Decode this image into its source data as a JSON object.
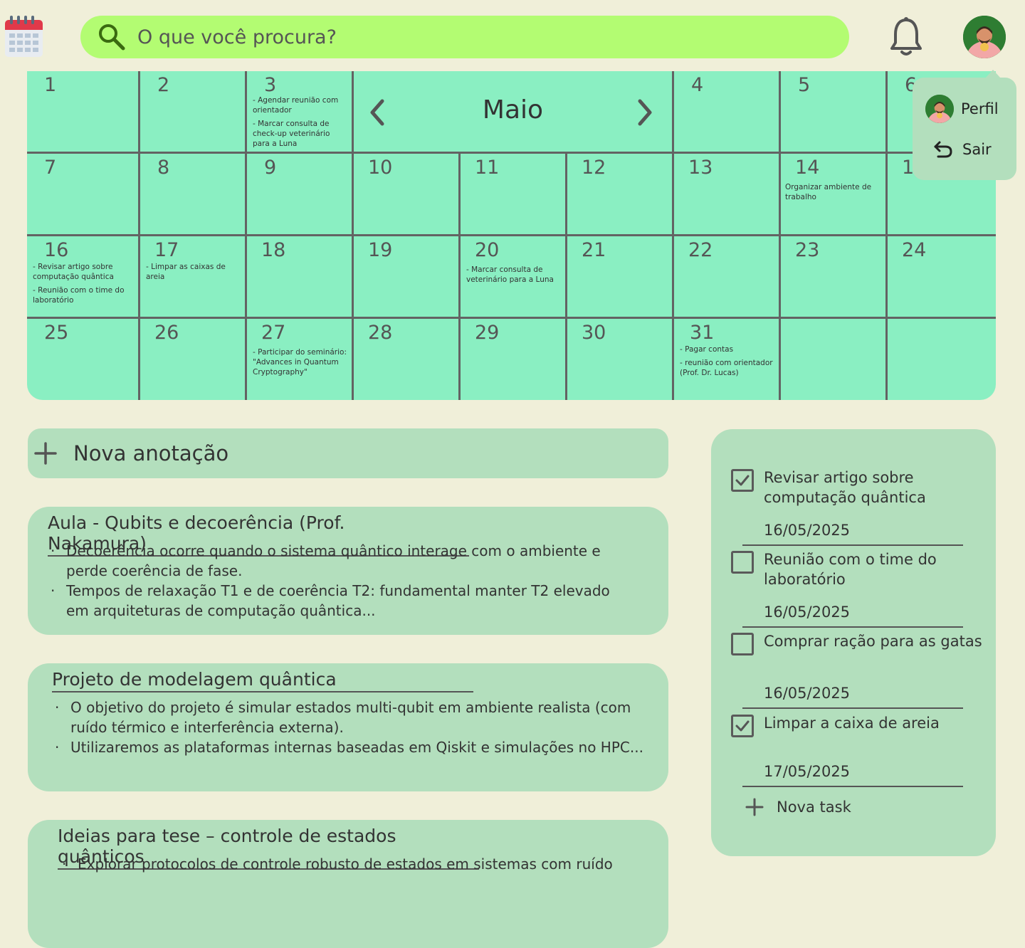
{
  "search": {
    "placeholder": "O que você procura?"
  },
  "calendar": {
    "month": "Maio",
    "days": {
      "d1": "1",
      "d2": "2",
      "d3": "3",
      "d4": "4",
      "d5": "5",
      "d6": "6",
      "d7": "7",
      "d8": "8",
      "d9": "9",
      "d10": "10",
      "d11": "11",
      "d12": "12",
      "d13": "13",
      "d14": "14",
      "d15": "15",
      "d16": "16",
      "d17": "17",
      "d18": "18",
      "d19": "19",
      "d20": "20",
      "d21": "21",
      "d22": "22",
      "d23": "23",
      "d24": "24",
      "d25": "25",
      "d26": "26",
      "d27": "27",
      "d28": "28",
      "d29": "29",
      "d30": "30",
      "d31": "31"
    },
    "events": {
      "d3": [
        "- Agendar reunião com orientador",
        "- Marcar consulta de check-up veterinário para a Luna"
      ],
      "d14": [
        "Organizar ambiente de trabalho"
      ],
      "d16": [
        "- Revisar artigo sobre computação quântica",
        "- Reunião com o time do laboratório"
      ],
      "d17": [
        "- Limpar as caixas de areia"
      ],
      "d20": [
        "- Marcar consulta de veterinário para a Luna"
      ],
      "d27": [
        "- Participar do seminário: \"Advances in Quantum Cryptography\""
      ],
      "d31": [
        "- Pagar contas",
        "- reunião com orientador (Prof. Dr. Lucas)"
      ]
    }
  },
  "profile_menu": {
    "perfil": "Perfil",
    "sair": "Sair"
  },
  "notes": {
    "new_label": "Nova anotação",
    "items": [
      {
        "title": "Aula - Qubits e decoerência (Prof. Nakamura)",
        "bullets": [
          "Decoerência ocorre quando o sistema quântico interage com o ambiente e perde coerência de fase.",
          "Tempos de relaxação T1 e de coerência T2: fundamental manter T2 elevado em arquiteturas de computação quântica..."
        ]
      },
      {
        "title": "Projeto de modelagem quântica",
        "bullets": [
          "O objetivo do projeto é simular estados multi-qubit em ambiente realista (com ruído térmico e interferência externa).",
          "Utilizaremos as plataformas internas baseadas em Qiskit e simulações no HPC..."
        ]
      },
      {
        "title": "Ideias para tese – controle de estados quânticos",
        "bullets": [
          "Explorar protocolos de controle robusto de estados em sistemas com ruído"
        ]
      }
    ]
  },
  "tasks": {
    "items": [
      {
        "label": "Revisar artigo sobre computação quântica",
        "date": "16/05/2025",
        "checked": true
      },
      {
        "label": "Reunião com o time do laboratório",
        "date": "16/05/2025",
        "checked": false
      },
      {
        "label": "Comprar ração para as gatas",
        "date": "16/05/2025",
        "checked": false
      },
      {
        "label": "Limpar a caixa de areia",
        "date": "17/05/2025",
        "checked": true
      }
    ],
    "new_label": "Nova task"
  },
  "colors": {
    "background": "#f0efd9",
    "search": "#b3fc72",
    "calendar": "#8aefc2",
    "panel": "#b3dfbd",
    "grid": "#636363"
  }
}
